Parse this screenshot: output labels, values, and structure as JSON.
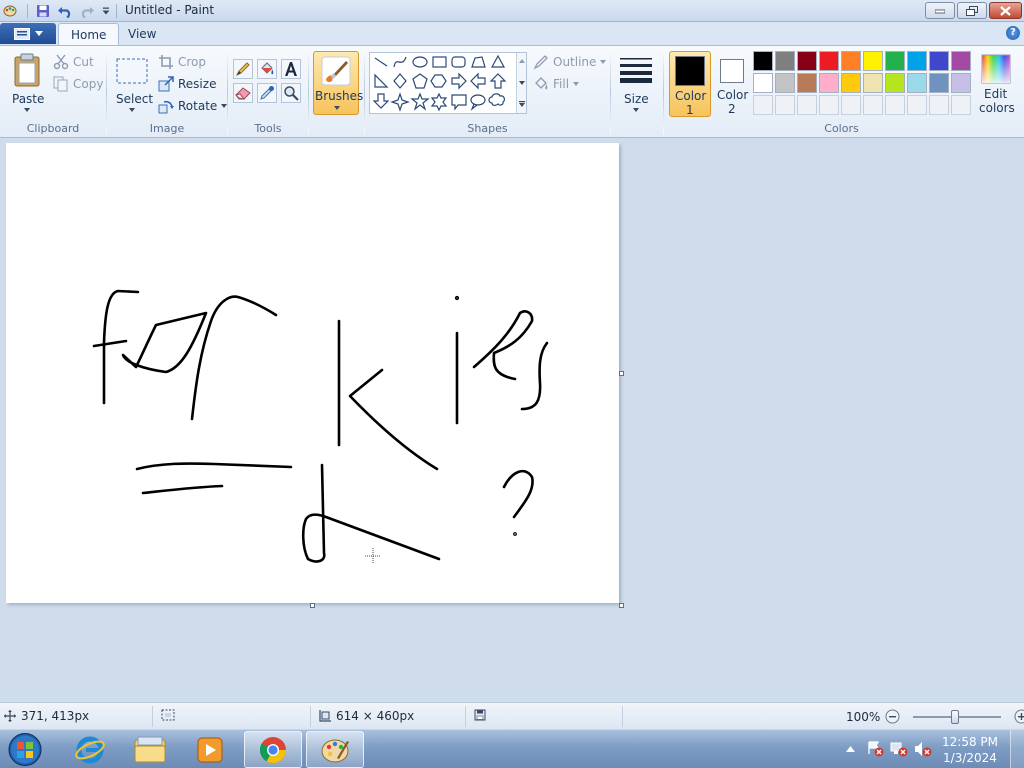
{
  "window": {
    "title": "Untitled - Paint"
  },
  "tabs": [
    {
      "label": "Home",
      "active": true
    },
    {
      "label": "View",
      "active": false
    }
  ],
  "clipboard": {
    "paste_label": "Paste",
    "cut_label": "Cut",
    "copy_label": "Copy",
    "group_label": "Clipboard"
  },
  "image": {
    "select_label": "Select",
    "crop_label": "Crop",
    "resize_label": "Resize",
    "rotate_label": "Rotate",
    "group_label": "Image"
  },
  "tools": {
    "group_label": "Tools",
    "items": [
      "pencil-icon",
      "fill-bucket-icon",
      "text-icon",
      "eraser-icon",
      "color-picker-icon",
      "magnifier-icon"
    ]
  },
  "brushes": {
    "label": "Brushes"
  },
  "shapes": {
    "group_label": "Shapes",
    "outline_label": "Outline",
    "fill_label": "Fill",
    "items": [
      "line",
      "curve",
      "oval",
      "rectangle",
      "rounded-rectangle",
      "polygon",
      "triangle",
      "right-triangle",
      "diamond",
      "pentagon",
      "hexagon",
      "right-arrow",
      "left-arrow",
      "up-arrow",
      "down-arrow",
      "four-point-star",
      "five-point-star",
      "six-point-star",
      "rounded-callout",
      "oval-callout",
      "cloud-callout"
    ]
  },
  "size": {
    "label": "Size"
  },
  "colors": {
    "color1_label_line1": "Color",
    "color1_label_line2": "1",
    "color2_label_line1": "Color",
    "color2_label_line2": "2",
    "color1_value": "#000000",
    "color2_value": "#ffffff",
    "group_label": "Colors",
    "edit_label_line1": "Edit",
    "edit_label_line2": "colors",
    "palette_row1": [
      "#000000",
      "#7f7f7f",
      "#880015",
      "#ed1c24",
      "#ff7f27",
      "#fff200",
      "#22b14c",
      "#00a2e8",
      "#3f48cc",
      "#a349a4"
    ],
    "palette_row2": [
      "#ffffff",
      "#c3c3c3",
      "#b97a57",
      "#ffaec9",
      "#ffc90e",
      "#efe4b0",
      "#b5e61d",
      "#99d9ea",
      "#7092be",
      "#c8bfe7"
    ]
  },
  "status": {
    "cursor_position": "371, 413px",
    "canvas_size": "614 × 460px",
    "zoom": "100%"
  },
  "taskbar": {
    "apps": [
      "start-orb-icon",
      "internet-explorer-icon",
      "file-explorer-icon",
      "media-player-icon",
      "chrome-icon",
      "paint-icon"
    ],
    "time": "12:58 PM",
    "date": "1/3/2024"
  }
}
